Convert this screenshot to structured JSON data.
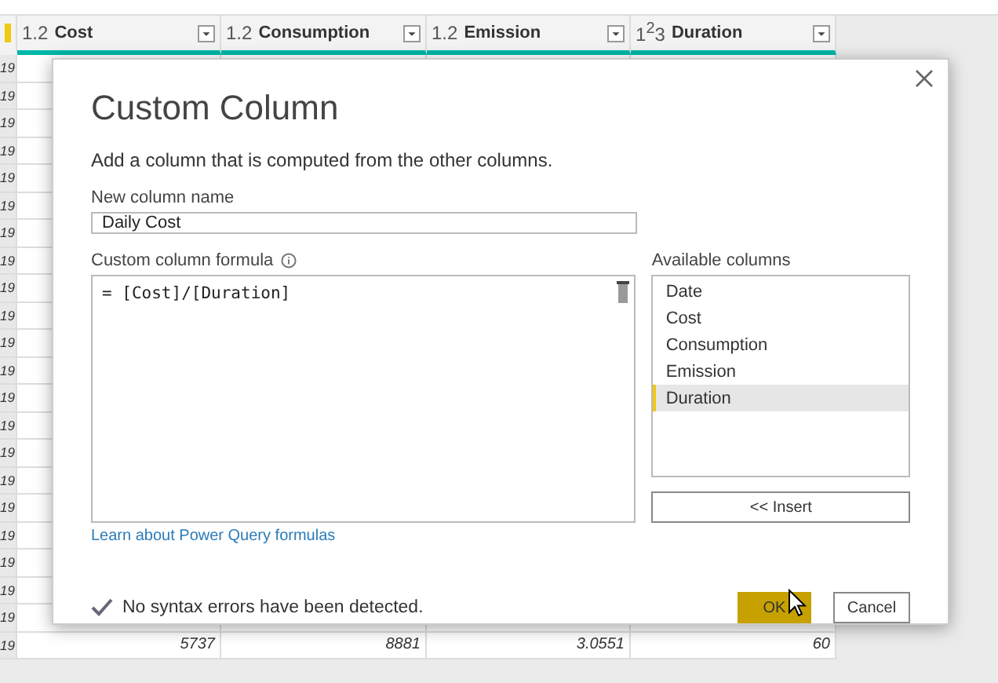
{
  "table": {
    "columns": [
      {
        "type": "1.2",
        "label": "Cost"
      },
      {
        "type": "1.2",
        "label": "Consumption"
      },
      {
        "type": "1.2",
        "label": "Emission"
      },
      {
        "type": "1$^{2}$3",
        "label": "Duration"
      }
    ],
    "rows": [
      {
        "row_number": "19"
      },
      {
        "row_number": "19"
      },
      {
        "row_number": "19"
      },
      {
        "row_number": "19"
      },
      {
        "row_number": "19"
      },
      {
        "row_number": "19"
      },
      {
        "row_number": "19"
      },
      {
        "row_number": "19"
      },
      {
        "row_number": "19"
      },
      {
        "row_number": "19"
      },
      {
        "row_number": "19"
      },
      {
        "row_number": "19"
      },
      {
        "row_number": "19"
      },
      {
        "row_number": "19"
      },
      {
        "row_number": "19"
      },
      {
        "row_number": "19"
      },
      {
        "row_number": "19"
      },
      {
        "row_number": "19"
      },
      {
        "row_number": "19"
      },
      {
        "row_number": "19"
      },
      {
        "row_number": "19"
      },
      {
        "row_number": "19",
        "cells": [
          "5737",
          "8881",
          "3.0551",
          "60"
        ]
      }
    ]
  },
  "dialog": {
    "title": "Custom Column",
    "description": "Add a column that is computed from the other columns.",
    "name_label": "New column name",
    "name_value": "Daily Cost",
    "formula_label": "Custom column formula",
    "formula": "= [Cost]/[Duration]",
    "available_label": "Available columns",
    "available_columns": [
      {
        "label": "Date",
        "selected": false
      },
      {
        "label": "Cost",
        "selected": false
      },
      {
        "label": "Consumption",
        "selected": false
      },
      {
        "label": "Emission",
        "selected": false
      },
      {
        "label": "Duration",
        "selected": true
      }
    ],
    "insert_button": "<< Insert",
    "link": "Learn about Power Query formulas",
    "status": "No syntax errors have been detected.",
    "buttons": [
      {
        "label": "OK",
        "kind": "primary"
      },
      {
        "label": "Cancel",
        "kind": "secondary"
      }
    ]
  }
}
